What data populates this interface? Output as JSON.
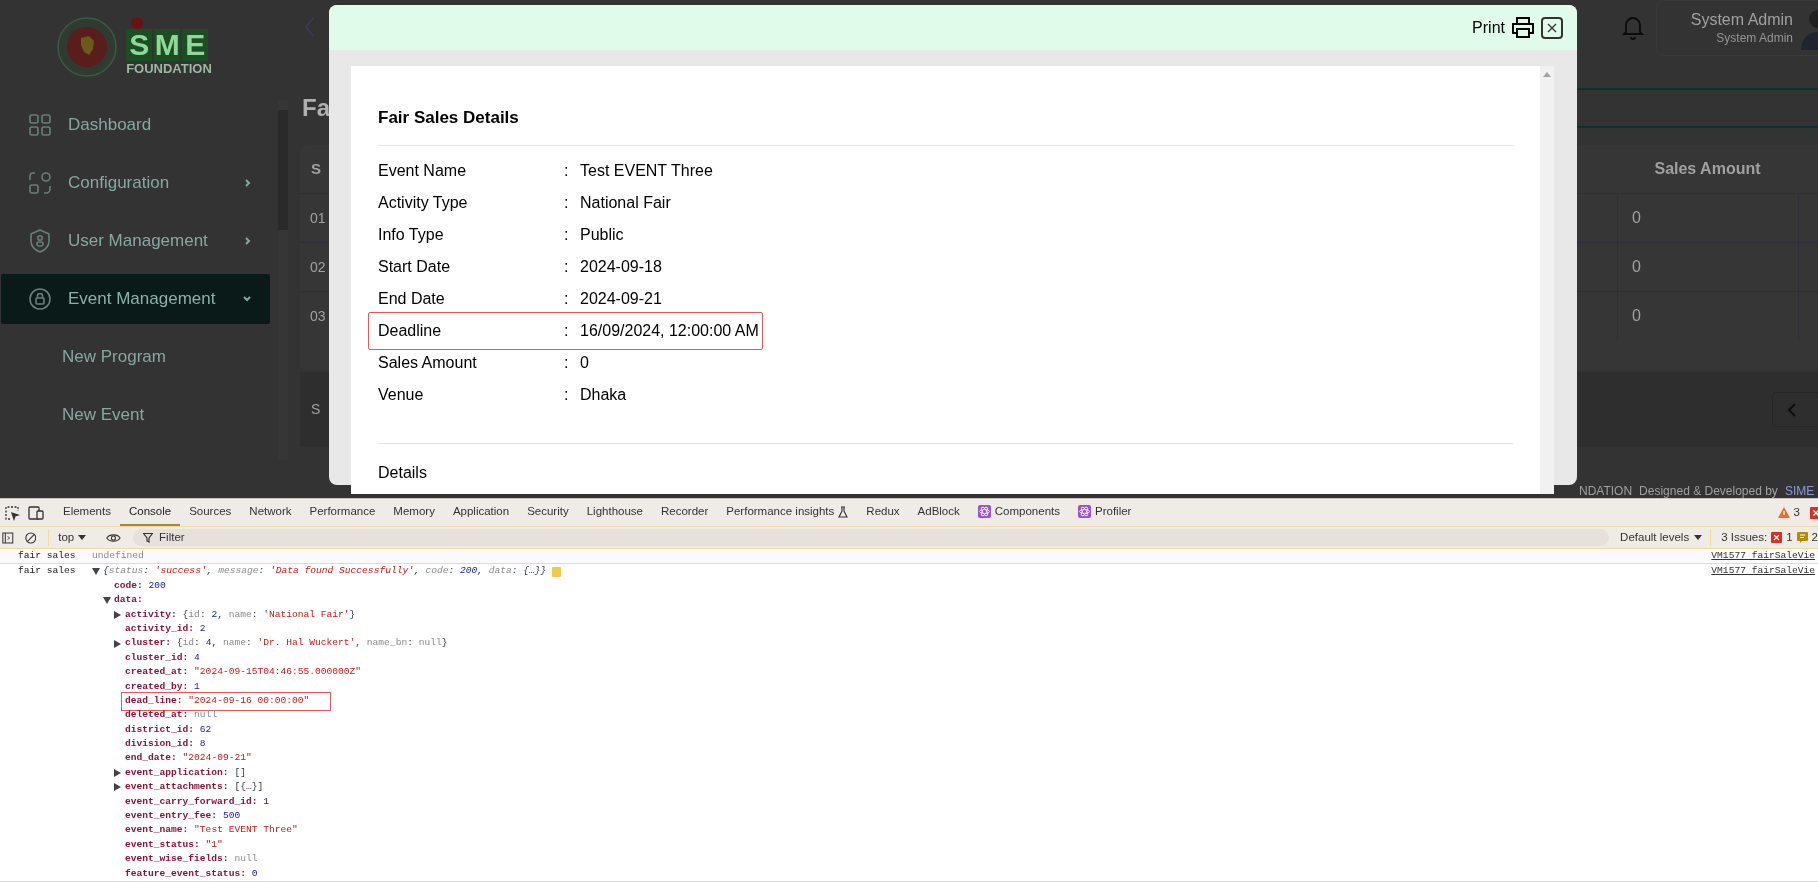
{
  "sidebar": {
    "logo": {
      "letters": [
        "S",
        "M",
        "E"
      ],
      "subtitle": "FOUNDATION"
    },
    "items": [
      {
        "label": "Dashboard",
        "kind": "link",
        "selected": false
      },
      {
        "label": "Configuration",
        "kind": "menu",
        "expanded": false,
        "selected": false
      },
      {
        "label": "User Management",
        "kind": "menu",
        "expanded": false,
        "selected": false
      },
      {
        "label": "Event Management",
        "kind": "menu",
        "expanded": true,
        "selected": true,
        "children": [
          {
            "label": "New Program",
            "selected": false
          },
          {
            "label": "New Event",
            "selected": false
          }
        ]
      }
    ]
  },
  "header": {
    "user_name": "System Admin",
    "user_role": "System Admin"
  },
  "page": {
    "title": "Fa",
    "table": {
      "columns": [
        "S",
        "Sales Amount"
      ],
      "rows": [
        [
          "01",
          "0"
        ],
        [
          "02",
          "0"
        ],
        [
          "03",
          "0"
        ]
      ]
    },
    "summary": "S"
  },
  "footer": [
    {
      "text": "NDATION",
      "kind": "plain"
    },
    {
      "text": "Designed & Developed by",
      "kind": "plain"
    },
    {
      "text": "SIME",
      "kind": "link"
    }
  ],
  "modal": {
    "print_label": "Print",
    "title": "Fair Sales Details",
    "fields": [
      {
        "label": "Event Name",
        "separator": ":",
        "value": "Test EVENT Three",
        "highlighted": false
      },
      {
        "label": "Activity Type",
        "separator": ":",
        "value": "National Fair",
        "highlighted": false
      },
      {
        "label": "Info Type",
        "separator": ":",
        "value": "Public",
        "highlighted": false
      },
      {
        "label": "Start Date",
        "separator": ":",
        "value": "2024-09-18",
        "highlighted": false
      },
      {
        "label": "End Date",
        "separator": ":",
        "value": "2024-09-21",
        "highlighted": false
      },
      {
        "label": "Deadline",
        "separator": ":",
        "value": "16/09/2024, 12:00:00 AM",
        "highlighted": true
      },
      {
        "label": "Sales Amount",
        "separator": ":",
        "value": "0",
        "highlighted": false
      },
      {
        "label": "Venue",
        "separator": ":",
        "value": "Dhaka",
        "highlighted": false
      }
    ],
    "sections": [
      "Details"
    ]
  },
  "devtools": {
    "tabs": [
      {
        "label": "Elements",
        "kind": "plain",
        "selected": false
      },
      {
        "label": "Console",
        "kind": "plain",
        "selected": true
      },
      {
        "label": "Sources",
        "kind": "plain",
        "selected": false
      },
      {
        "label": "Network",
        "kind": "plain",
        "selected": false
      },
      {
        "label": "Performance",
        "kind": "plain",
        "selected": false
      },
      {
        "label": "Memory",
        "kind": "plain",
        "selected": false
      },
      {
        "label": "Application",
        "kind": "plain",
        "selected": false
      },
      {
        "label": "Security",
        "kind": "plain",
        "selected": false
      },
      {
        "label": "Lighthouse",
        "kind": "plain",
        "selected": false
      },
      {
        "label": "Recorder",
        "kind": "plain",
        "selected": false
      },
      {
        "label": "Performance insights",
        "kind": "experimental",
        "selected": false
      },
      {
        "label": "Redux",
        "kind": "plain",
        "selected": false
      },
      {
        "label": "AdBlock",
        "kind": "plain",
        "selected": false
      },
      {
        "label": "Components",
        "kind": "extension",
        "selected": false
      },
      {
        "label": "Profiler",
        "kind": "extension",
        "selected": false
      }
    ],
    "warning_count": "3",
    "context": "top",
    "filter_placeholder": "Filter",
    "levels": "Default levels",
    "issues_label": "3 Issues:",
    "issue_errors": "1",
    "issue_messages": "2"
  },
  "console": [
    {
      "label": "fair sales",
      "kind": "text",
      "value": "undefined",
      "source": "VM1577 fairSaleVie"
    },
    {
      "label": "fair sales",
      "kind": "object",
      "expanded": true,
      "source": "VM1577 fairSaleVie",
      "preview": [
        {
          "text": "{",
          "kind": "punct"
        },
        {
          "text": "status",
          "kind": "pkey"
        },
        {
          "text": ": ",
          "kind": "punct"
        },
        {
          "text": "'success'",
          "kind": "string"
        },
        {
          "text": ", ",
          "kind": "punct"
        },
        {
          "text": "message",
          "kind": "pkey"
        },
        {
          "text": ": ",
          "kind": "punct"
        },
        {
          "text": "'Data found Successfully'",
          "kind": "string"
        },
        {
          "text": ", ",
          "kind": "punct"
        },
        {
          "text": "code",
          "kind": "pkey"
        },
        {
          "text": ": ",
          "kind": "punct"
        },
        {
          "text": "200",
          "kind": "number"
        },
        {
          "text": ", ",
          "kind": "punct"
        },
        {
          "text": "data",
          "kind": "pkey"
        },
        {
          "text": ": ",
          "kind": "punct"
        },
        {
          "text": "{…}}",
          "kind": "punct"
        }
      ],
      "children": [
        {
          "key": "code:",
          "kind": "value",
          "highlighted": false,
          "parts": [
            {
              "text": "200",
              "kind": "number"
            }
          ]
        },
        {
          "key": "data:",
          "kind": "group",
          "expanded": true,
          "highlighted": false,
          "children": [
            {
              "key": "activity:",
              "kind": "group",
              "expanded": false,
              "highlighted": false,
              "parts": [
                {
                  "text": "{",
                  "kind": "punct"
                },
                {
                  "text": "id",
                  "kind": "pkey"
                },
                {
                  "text": ": ",
                  "kind": "punct"
                },
                {
                  "text": "2",
                  "kind": "number"
                },
                {
                  "text": ", ",
                  "kind": "punct"
                },
                {
                  "text": "name",
                  "kind": "pkey"
                },
                {
                  "text": ": ",
                  "kind": "punct"
                },
                {
                  "text": "'National Fair'",
                  "kind": "string"
                },
                {
                  "text": "}",
                  "kind": "punct"
                }
              ]
            },
            {
              "key": "activity_id:",
              "kind": "value",
              "highlighted": false,
              "parts": [
                {
                  "text": "2",
                  "kind": "number"
                }
              ]
            },
            {
              "key": "cluster:",
              "kind": "group",
              "expanded": false,
              "highlighted": false,
              "parts": [
                {
                  "text": "{",
                  "kind": "punct"
                },
                {
                  "text": "id",
                  "kind": "pkey"
                },
                {
                  "text": ": ",
                  "kind": "punct"
                },
                {
                  "text": "4",
                  "kind": "number"
                },
                {
                  "text": ", ",
                  "kind": "punct"
                },
                {
                  "text": "name",
                  "kind": "pkey"
                },
                {
                  "text": ": ",
                  "kind": "punct"
                },
                {
                  "text": "'Dr. Hal Wuckert'",
                  "kind": "string"
                },
                {
                  "text": ", ",
                  "kind": "punct"
                },
                {
                  "text": "name_bn",
                  "kind": "pkey"
                },
                {
                  "text": ": ",
                  "kind": "punct"
                },
                {
                  "text": "null",
                  "kind": "null"
                },
                {
                  "text": "}",
                  "kind": "punct"
                }
              ]
            },
            {
              "key": "cluster_id:",
              "kind": "value",
              "highlighted": false,
              "parts": [
                {
                  "text": "4",
                  "kind": "number"
                }
              ]
            },
            {
              "key": "created_at:",
              "kind": "value",
              "highlighted": false,
              "parts": [
                {
                  "text": "\"2024-09-15T04:46:55.000000Z\"",
                  "kind": "string"
                }
              ]
            },
            {
              "key": "created_by:",
              "kind": "value",
              "highlighted": false,
              "parts": [
                {
                  "text": "1",
                  "kind": "number"
                }
              ]
            },
            {
              "key": "dead_line:",
              "kind": "value",
              "highlighted": true,
              "parts": [
                {
                  "text": "\"2024-09-16 00:00:00\"",
                  "kind": "string"
                }
              ]
            },
            {
              "key": "deleted_at:",
              "kind": "value",
              "highlighted": false,
              "parts": [
                {
                  "text": "null",
                  "kind": "null"
                }
              ]
            },
            {
              "key": "district_id:",
              "kind": "value",
              "highlighted": false,
              "parts": [
                {
                  "text": "62",
                  "kind": "number"
                }
              ]
            },
            {
              "key": "division_id:",
              "kind": "value",
              "highlighted": false,
              "parts": [
                {
                  "text": "8",
                  "kind": "number"
                }
              ]
            },
            {
              "key": "end_date:",
              "kind": "value",
              "highlighted": false,
              "parts": [
                {
                  "text": "\"2024-09-21\"",
                  "kind": "string"
                }
              ]
            },
            {
              "key": "event_application:",
              "kind": "group",
              "expanded": false,
              "highlighted": false,
              "parts": [
                {
                  "text": "[]",
                  "kind": "punct"
                }
              ]
            },
            {
              "key": "event_attachments:",
              "kind": "group",
              "expanded": false,
              "highlighted": false,
              "parts": [
                {
                  "text": "[{…}]",
                  "kind": "punct"
                }
              ]
            },
            {
              "key": "event_carry_forward_id:",
              "kind": "value",
              "highlighted": false,
              "parts": [
                {
                  "text": "1",
                  "kind": "number"
                }
              ]
            },
            {
              "key": "event_entry_fee:",
              "kind": "value",
              "highlighted": false,
              "parts": [
                {
                  "text": "500",
                  "kind": "number"
                }
              ]
            },
            {
              "key": "event_name:",
              "kind": "value",
              "highlighted": false,
              "parts": [
                {
                  "text": "\"Test EVENT Three\"",
                  "kind": "string"
                }
              ]
            },
            {
              "key": "event_status:",
              "kind": "value",
              "highlighted": false,
              "parts": [
                {
                  "text": "\"1\"",
                  "kind": "string"
                }
              ]
            },
            {
              "key": "event_wise_fields:",
              "kind": "value",
              "highlighted": false,
              "parts": [
                {
                  "text": "null",
                  "kind": "null"
                }
              ]
            },
            {
              "key": "feature_event_status:",
              "kind": "value",
              "highlighted": false,
              "parts": [
                {
                  "text": "0",
                  "kind": "number"
                }
              ]
            }
          ]
        }
      ]
    }
  ]
}
